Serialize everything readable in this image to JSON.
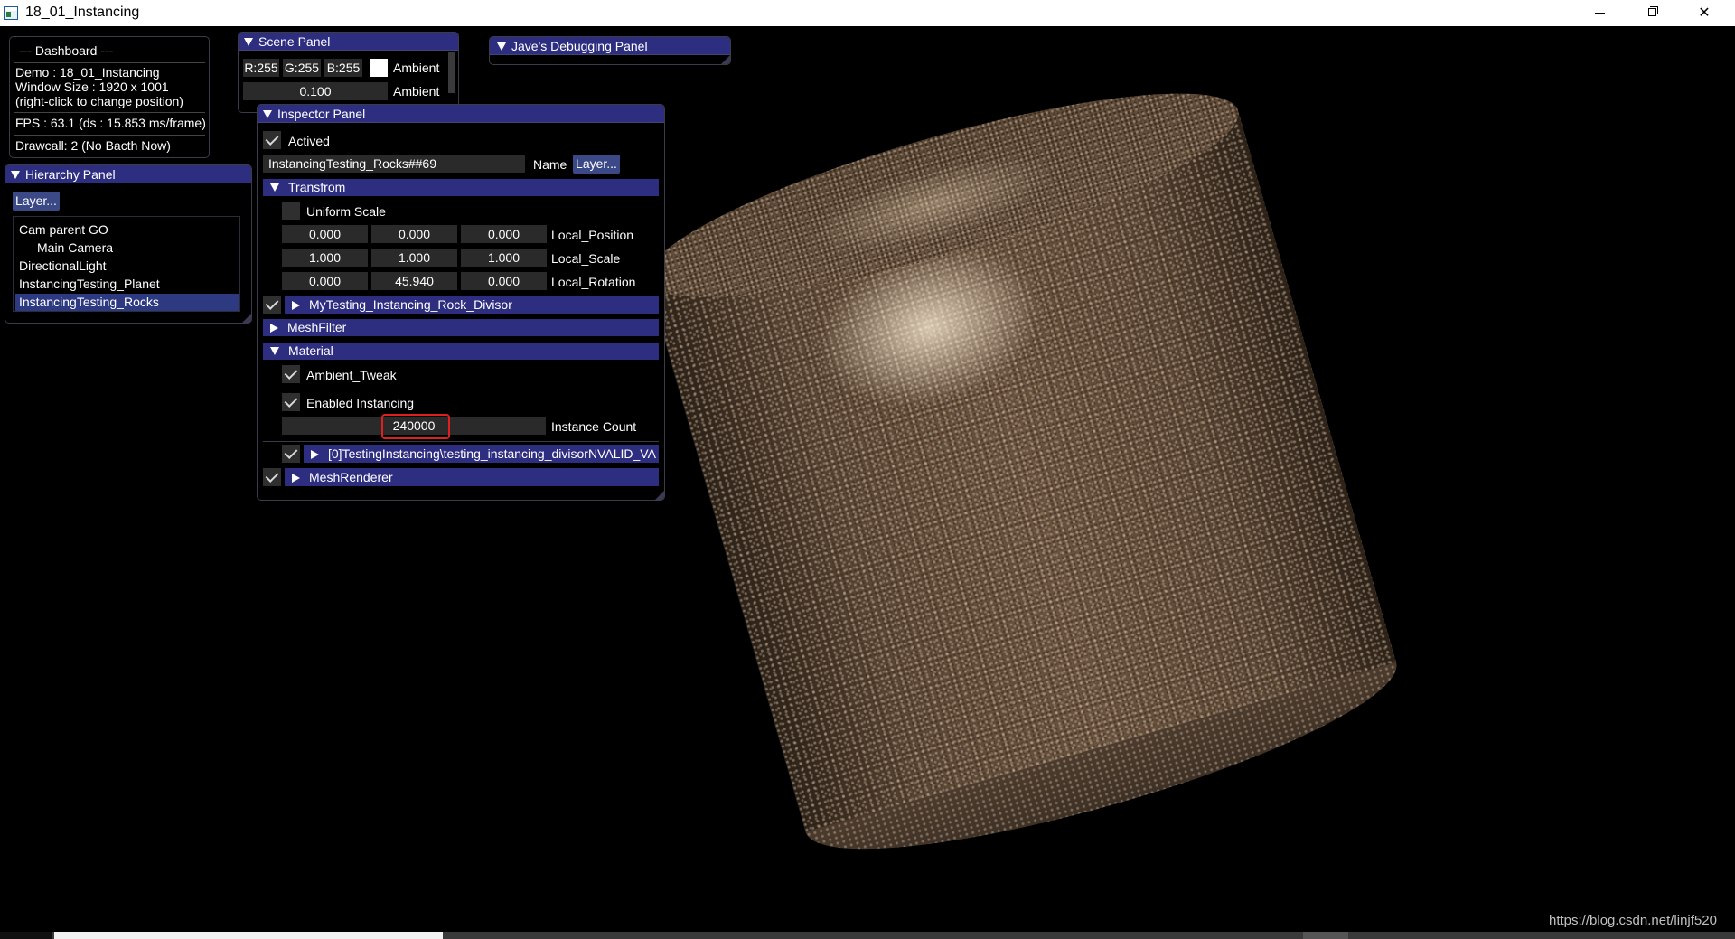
{
  "window": {
    "title": "18_01_Instancing"
  },
  "dashboard": {
    "header": "--- Dashboard ---",
    "demo": "Demo : 18_01_Instancing",
    "window_size": "Window Size : 1920 x 1001",
    "hint": "(right-click to change position)",
    "fps": "FPS : 63.1 (ds : 15.853 ms/frame)",
    "drawcall": "Drawcall: 2 (No Bacth Now)"
  },
  "scene_panel": {
    "title": "Scene Panel",
    "r": "R:255",
    "g": "G:255",
    "b": "B:255",
    "color_label": "Ambient",
    "ambient_value": "0.100",
    "ambient_label": "Ambient",
    "swatch_color": "#ffffff"
  },
  "debug_panel": {
    "title": "Jave's Debugging Panel"
  },
  "hierarchy": {
    "title": "Hierarchy Panel",
    "layer_button": "Layer...",
    "items": [
      "Cam parent GO",
      "Main Camera",
      "DirectionalLight",
      "InstancingTesting_Planet",
      "InstancingTesting_Rocks"
    ]
  },
  "inspector": {
    "title": "Inspector Panel",
    "actived_label": "Actived",
    "name_value": "InstancingTesting_Rocks##69",
    "name_label": "Name",
    "layer_button": "Layer...",
    "transform": {
      "title": "Transfrom",
      "uniform_scale": "Uniform Scale",
      "position": [
        "0.000",
        "0.000",
        "0.000"
      ],
      "position_label": "Local_Position",
      "scale": [
        "1.000",
        "1.000",
        "1.000"
      ],
      "scale_label": "Local_Scale",
      "rotation": [
        "0.000",
        "45.940",
        "0.000"
      ],
      "rotation_label": "Local_Rotation"
    },
    "component_divisor": "MyTesting_Instancing_Rock_Divisor",
    "mesh_filter": "MeshFilter",
    "material": {
      "title": "Material",
      "ambient_tweak": "Ambient_Tweak",
      "enabled_instancing": "Enabled Instancing",
      "instance_count": "240000",
      "instance_count_label": "Instance Count",
      "shader_entry": "[0]TestingInstancing\\testing_instancing_divisorNVALID_VA"
    },
    "mesh_renderer": "MeshRenderer"
  },
  "watermark": "https://blog.csdn.net/linjf520",
  "colors": {
    "header_bg": "#2e2e80",
    "selected_bg": "#2d3a82",
    "button_bg": "#3b4a86",
    "highlight": "#e02020"
  }
}
